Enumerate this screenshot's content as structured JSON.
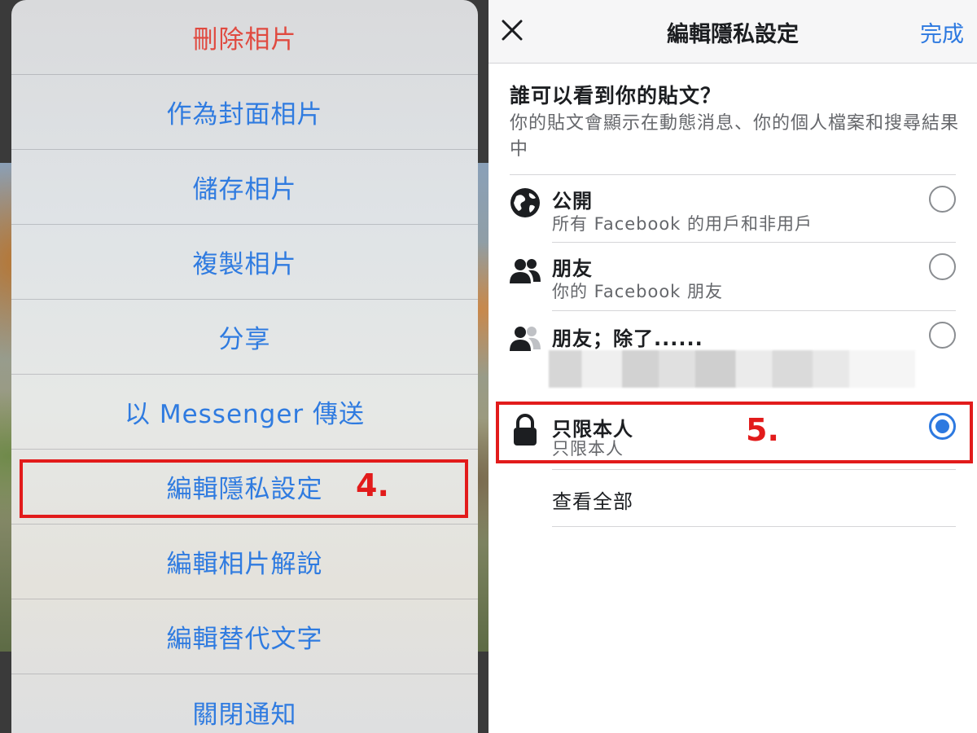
{
  "left_panel": {
    "action_sheet": [
      {
        "label": "刪除相片",
        "style": "destructive"
      },
      {
        "label": "作為封面相片",
        "style": "default"
      },
      {
        "label": "儲存相片",
        "style": "default"
      },
      {
        "label": "複製相片",
        "style": "default"
      },
      {
        "label": "分享",
        "style": "default"
      },
      {
        "label": "以 Messenger 傳送",
        "style": "default"
      },
      {
        "label": "編輯隱私設定",
        "style": "default"
      },
      {
        "label": "編輯相片解說",
        "style": "default"
      },
      {
        "label": "編輯替代文字",
        "style": "default"
      },
      {
        "label": "關閉通知",
        "style": "default"
      }
    ],
    "step_label": "4."
  },
  "right_panel": {
    "nav": {
      "close_icon": "close-icon",
      "title": "編輯隱私設定",
      "done": "完成"
    },
    "question": "誰可以看到你的貼文？",
    "description": "你的貼文會顯示在動態消息、你的個人檔案和搜尋結果中",
    "options": [
      {
        "icon": "globe-icon",
        "title": "公開",
        "subtitle": "所有 Facebook 的用戶和非用戶",
        "selected": false
      },
      {
        "icon": "friends-icon",
        "title": "朋友",
        "subtitle": "你的 Facebook 朋友",
        "selected": false
      },
      {
        "icon": "friends-except-icon",
        "title": "朋友；除了......",
        "subtitle": "",
        "selected": false
      },
      {
        "icon": "lock-icon",
        "title": "只限本人",
        "subtitle": "只限本人",
        "selected": true
      }
    ],
    "see_all": "查看全部",
    "step_label": "5."
  },
  "colors": {
    "ios_blue": "#2f7be0",
    "destructive_red": "#e04a40",
    "annotation_red": "#e21b1b",
    "fb_blue": "#2d79e0"
  }
}
